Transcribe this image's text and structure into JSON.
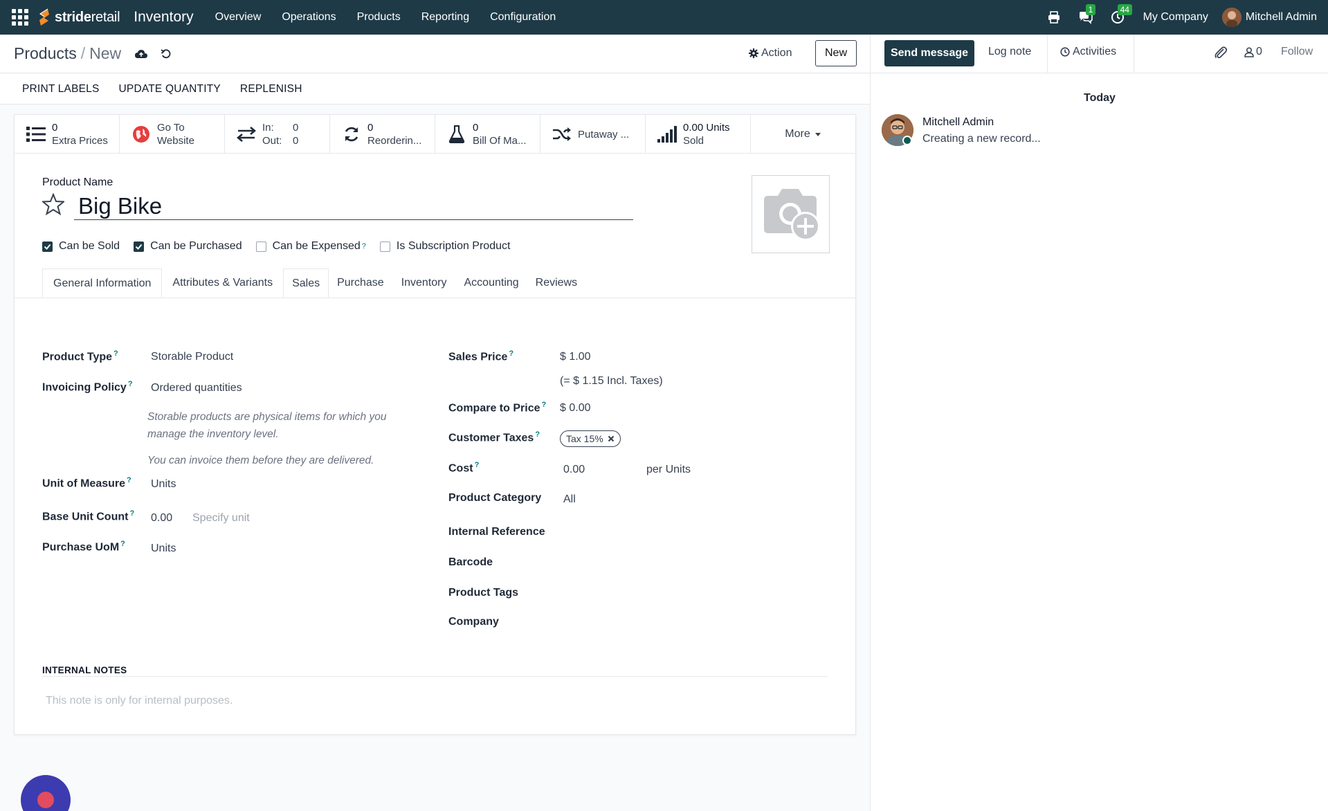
{
  "navbar": {
    "brand_bold": "stride",
    "brand_light": "retail",
    "app_name": "Inventory",
    "menu": [
      "Overview",
      "Operations",
      "Products",
      "Reporting",
      "Configuration"
    ],
    "messages_badge": "1",
    "activities_badge": "44",
    "company": "My Company",
    "user": "Mitchell Admin"
  },
  "control_panel": {
    "breadcrumb_parent": "Products",
    "breadcrumb_sep": "/",
    "breadcrumb_current": "New",
    "action_label": "Action",
    "new_label": "New"
  },
  "statusbar": {
    "buttons": [
      "PRINT LABELS",
      "UPDATE QUANTITY",
      "REPLENISH"
    ]
  },
  "smart_buttons": {
    "extra_prices": {
      "value": "0",
      "label": "Extra Prices"
    },
    "website": {
      "line1": "Go To",
      "line2": "Website"
    },
    "in_out": {
      "in_label": "In:",
      "in_value": "0",
      "out_label": "Out:",
      "out_value": "0"
    },
    "reordering": {
      "value": "0",
      "label": "Reorderin..."
    },
    "bom": {
      "value": "0",
      "label": "Bill Of Ma..."
    },
    "putaway": {
      "label": "Putaway ..."
    },
    "sold": {
      "value": "0.00 Units",
      "label": "Sold"
    },
    "more": "More"
  },
  "product": {
    "name_label": "Product Name",
    "name": "Big Bike",
    "checkboxes": [
      {
        "label": "Can be Sold",
        "checked": true
      },
      {
        "label": "Can be Purchased",
        "checked": true
      },
      {
        "label": "Can be Expensed",
        "checked": false
      },
      {
        "label": "Is Subscription Product",
        "checked": false
      }
    ]
  },
  "tabs": [
    "General Information",
    "Attributes & Variants",
    "Sales",
    "Purchase",
    "Inventory",
    "Accounting",
    "Reviews"
  ],
  "general": {
    "product_type_label": "Product Type",
    "product_type": "Storable Product",
    "invoicing_policy_label": "Invoicing Policy",
    "invoicing_policy": "Ordered quantities",
    "help_1": "Storable products are physical items for which you manage the inventory level.",
    "help_2": "You can invoice them before they are delivered.",
    "uom_label": "Unit of Measure",
    "uom": "Units",
    "base_unit_count_label": "Base Unit Count",
    "base_unit_count": "0.00",
    "specify_unit_placeholder": "Specify unit",
    "purchase_uom_label": "Purchase UoM",
    "purchase_uom": "Units",
    "sales_price_label": "Sales Price",
    "sales_price": "$ 1.00",
    "incl_taxes": "(= $ 1.15 Incl. Taxes)",
    "compare_price_label": "Compare to Price",
    "compare_price": "$ 0.00",
    "customer_taxes_label": "Customer Taxes",
    "tax_tag": "Tax 15%",
    "cost_label": "Cost",
    "cost": "0.00",
    "cost_unit": "per Units",
    "category_label": "Product Category",
    "category": "All",
    "internal_ref_label": "Internal Reference",
    "barcode_label": "Barcode",
    "tags_label": "Product Tags",
    "company_label": "Company"
  },
  "notes": {
    "title": "INTERNAL NOTES",
    "placeholder": "This note is only for internal purposes."
  },
  "chatter": {
    "send_message": "Send message",
    "log_note": "Log note",
    "activities": "Activities",
    "followers_count": "0",
    "follow": "Follow",
    "today": "Today",
    "author": "Mitchell Admin",
    "body": "Creating a new record..."
  },
  "colors": {
    "navbar": "#1e3a47",
    "badge": "#28a745",
    "help_mark": "#017e84",
    "chat_bubble": "#3d3bb0"
  }
}
